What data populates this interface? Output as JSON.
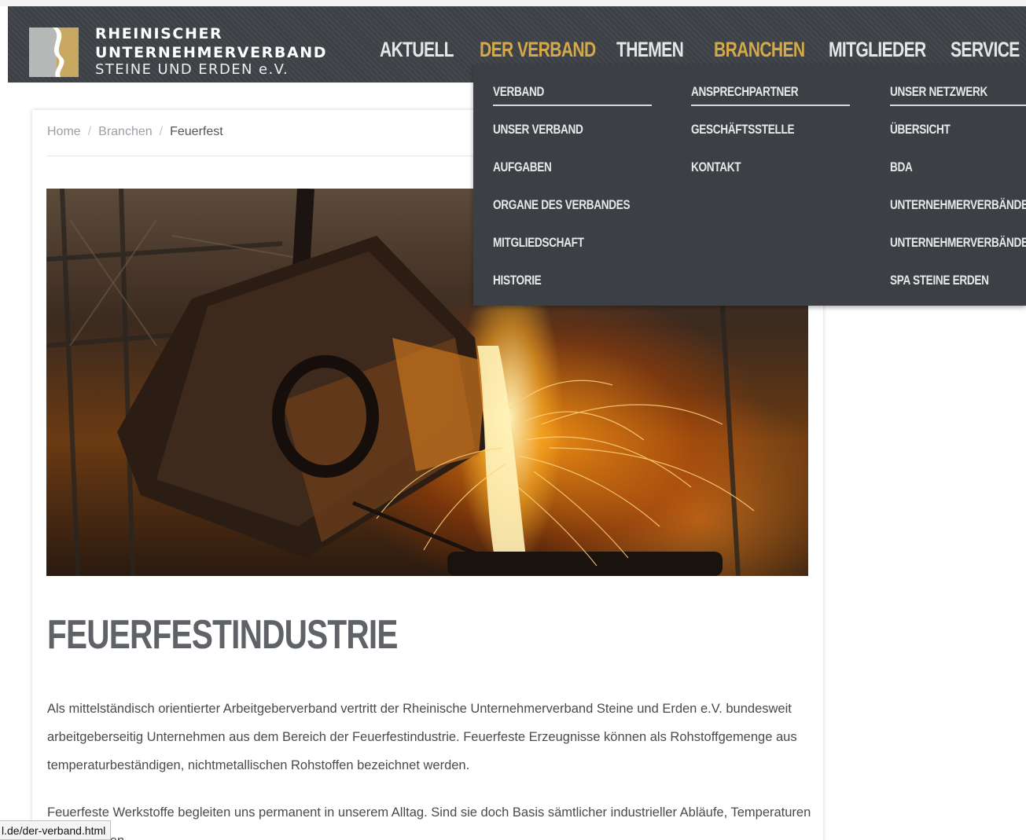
{
  "logo": {
    "line1": "RHEINISCHER",
    "line2": "UNTERNEHMERVERBAND",
    "line3": "STEINE UND ERDEN e.V.",
    "colors": {
      "gold": "#c9a862",
      "grey": "#b7b8b8"
    }
  },
  "nav": {
    "items": [
      {
        "label": "AKTUELL"
      },
      {
        "label": "DER VERBAND",
        "active": true
      },
      {
        "label": "THEMEN"
      },
      {
        "label": "BRANCHEN",
        "active": true
      },
      {
        "label": "MITGLIEDER"
      },
      {
        "label": "SERVICE"
      }
    ],
    "active_color": "#d3a94a"
  },
  "dropdown": {
    "columns": [
      {
        "heading": "VERBAND",
        "links": [
          "UNSER VERBAND",
          "AUFGABEN",
          "ORGANE DES VERBANDES",
          "MITGLIEDSCHAFT",
          "HISTORIE"
        ]
      },
      {
        "heading": "ANSPRECHPARTNER",
        "links": [
          "GESCHÄFTSSTELLE",
          "KONTAKT"
        ]
      },
      {
        "heading": "UNSER NETZWERK",
        "links": [
          "ÜBERSICHT",
          "BDA",
          "UNTERNEHMERVERBÄNDE R",
          "UNTERNEHMERVERBÄNDE N",
          "SPA STEINE ERDEN"
        ]
      }
    ]
  },
  "breadcrumb": {
    "home": "Home",
    "section": "Branchen",
    "current": "Feuerfest",
    "separator": "/"
  },
  "main": {
    "hero_alt_icon": "foundry-ladle-image",
    "title": "FEUERFESTINDUSTRIE",
    "paragraphs": [
      "Als mittelständisch orientierter Arbeitgeberverband vertritt der Rheinische Unternehmerverband Steine und Erden e.V. bundesweit arbeitgeberseitig Unternehmen aus dem Bereich der Feuerfestindustrie. Feuerfeste Erzeugnisse können als Rohstoffgemenge aus temperaturbeständigen, nichtmetallischen Rohstoffen bezeichnet werden.",
      "Feuerfeste Werkstoffe begleiten uns permanent in unserem Alltag. Sind sie doch Basis sämtlicher industrieller Abläufe, Temperaturen voraussetzen."
    ]
  },
  "statusbar": {
    "url": "l.de/der-verband.html"
  }
}
